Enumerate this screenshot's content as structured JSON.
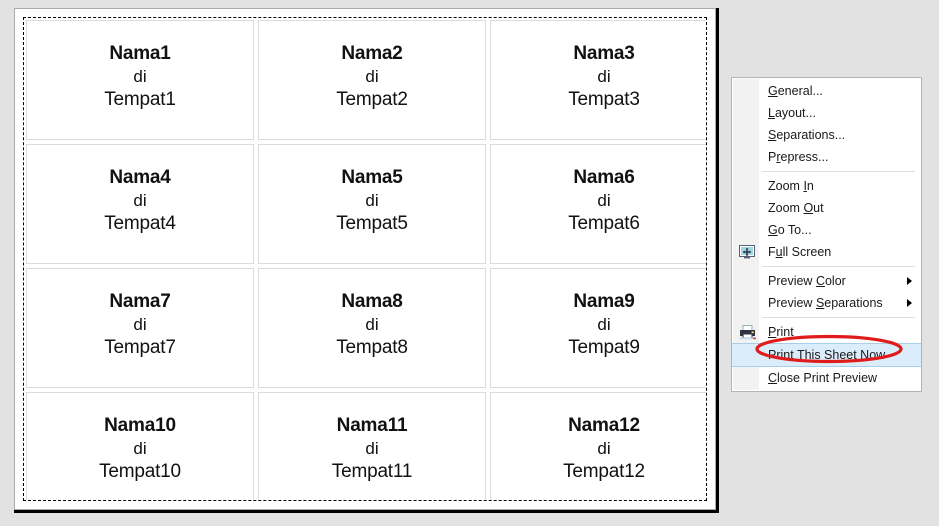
{
  "window": {
    "background_color": "#e2e2e2"
  },
  "preview": {
    "name": "print-preview-page",
    "page_background": "#ffffff",
    "margin_border_style": "dashed",
    "labels": [
      {
        "name": "Nama1",
        "connector": "di",
        "place": "Tempat1"
      },
      {
        "name": "Nama2",
        "connector": "di",
        "place": "Tempat2"
      },
      {
        "name": "Nama3",
        "connector": "di",
        "place": "Tempat3"
      },
      {
        "name": "Nama4",
        "connector": "di",
        "place": "Tempat4"
      },
      {
        "name": "Nama5",
        "connector": "di",
        "place": "Tempat5"
      },
      {
        "name": "Nama6",
        "connector": "di",
        "place": "Tempat6"
      },
      {
        "name": "Nama7",
        "connector": "di",
        "place": "Tempat7"
      },
      {
        "name": "Nama8",
        "connector": "di",
        "place": "Tempat8"
      },
      {
        "name": "Nama9",
        "connector": "di",
        "place": "Tempat9"
      },
      {
        "name": "Nama10",
        "connector": "di",
        "place": "Tempat10"
      },
      {
        "name": "Nama11",
        "connector": "di",
        "place": "Tempat11"
      },
      {
        "name": "Nama12",
        "connector": "di",
        "place": "Tempat12"
      }
    ]
  },
  "context_menu": {
    "highlight_color": "#dbedfb",
    "annotation_color": "#e01b1b",
    "groups": [
      {
        "items": [
          {
            "id": "general",
            "mnemonic": "G",
            "pre": "",
            "post": "eneral...",
            "icon": null,
            "submenu": false,
            "highlighted": false
          },
          {
            "id": "layout",
            "mnemonic": "L",
            "pre": "",
            "post": "ayout...",
            "icon": null,
            "submenu": false,
            "highlighted": false
          },
          {
            "id": "separations",
            "mnemonic": "S",
            "pre": "",
            "post": "eparations...",
            "icon": null,
            "submenu": false,
            "highlighted": false
          },
          {
            "id": "prepress",
            "mnemonic": "r",
            "pre": "P",
            "post": "epress...",
            "icon": null,
            "submenu": false,
            "highlighted": false
          }
        ]
      },
      {
        "items": [
          {
            "id": "zoom-in",
            "mnemonic": "I",
            "pre": "Zoom ",
            "post": "n",
            "icon": null,
            "submenu": false,
            "highlighted": false
          },
          {
            "id": "zoom-out",
            "mnemonic": "O",
            "pre": "Zoom ",
            "post": "ut",
            "icon": null,
            "submenu": false,
            "highlighted": false
          },
          {
            "id": "go-to",
            "mnemonic": "G",
            "pre": "",
            "post": "o To...",
            "icon": null,
            "submenu": false,
            "highlighted": false
          },
          {
            "id": "full-screen",
            "mnemonic": "u",
            "pre": "F",
            "post": "ll Screen",
            "icon": "full-screen-icon",
            "submenu": false,
            "highlighted": false
          }
        ]
      },
      {
        "items": [
          {
            "id": "preview-color",
            "mnemonic": "C",
            "pre": "Preview ",
            "post": "olor",
            "icon": null,
            "submenu": true,
            "highlighted": false
          },
          {
            "id": "preview-separations",
            "mnemonic": "S",
            "pre": "Preview ",
            "post": "eparations",
            "icon": null,
            "submenu": true,
            "highlighted": false
          }
        ]
      },
      {
        "items": [
          {
            "id": "print",
            "mnemonic": "P",
            "pre": "",
            "post": "rint",
            "icon": "printer-icon",
            "submenu": false,
            "highlighted": false
          },
          {
            "id": "print-this-sheet-now",
            "mnemonic": "T",
            "pre": "Print ",
            "post": "his Sheet Now",
            "icon": null,
            "submenu": false,
            "highlighted": true
          },
          {
            "id": "close-print-preview",
            "mnemonic": "C",
            "pre": "",
            "post": "lose Print Preview",
            "icon": null,
            "submenu": false,
            "highlighted": false
          }
        ]
      }
    ]
  }
}
